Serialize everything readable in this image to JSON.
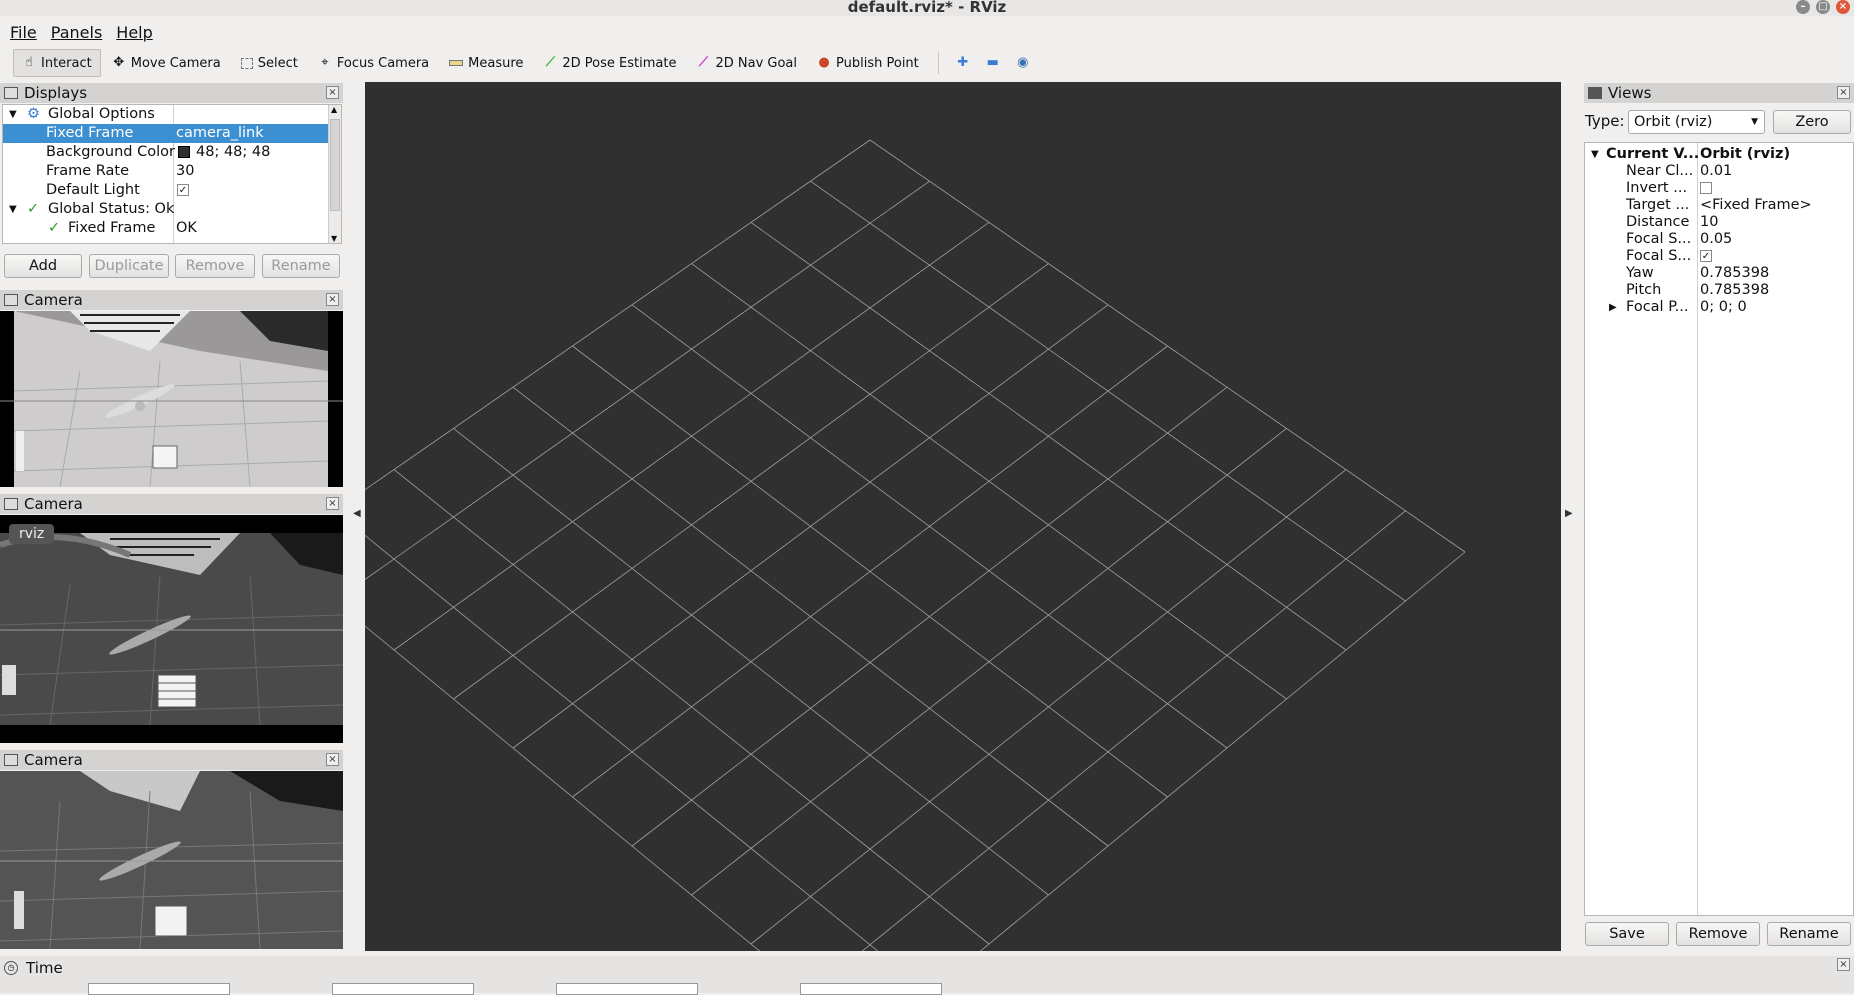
{
  "window": {
    "title": "default.rviz* - RViz"
  },
  "menu": {
    "file": "File",
    "panels": "Panels",
    "help": "Help"
  },
  "toolbar": {
    "interact": "Interact",
    "move_camera": "Move Camera",
    "select": "Select",
    "focus_camera": "Focus Camera",
    "measure": "Measure",
    "pose_estimate": "2D Pose Estimate",
    "nav_goal": "2D Nav Goal",
    "publish_point": "Publish Point"
  },
  "displays": {
    "title": "Displays",
    "rows": [
      {
        "key": "Global Options",
        "value": ""
      },
      {
        "key": "Fixed Frame",
        "value": "camera_link"
      },
      {
        "key": "Background Color",
        "value": "48; 48; 48"
      },
      {
        "key": "Frame Rate",
        "value": "30"
      },
      {
        "key": "Default Light",
        "value": ""
      },
      {
        "key": "Global Status: Ok",
        "value": ""
      },
      {
        "key": "Fixed Frame",
        "value": "OK"
      }
    ],
    "buttons": {
      "add": "Add",
      "duplicate": "Duplicate",
      "remove": "Remove",
      "rename": "Rename"
    }
  },
  "cameras": [
    {
      "title": "Camera",
      "overlay": ""
    },
    {
      "title": "Camera",
      "overlay": "rviz"
    },
    {
      "title": "Camera",
      "overlay": ""
    }
  ],
  "views": {
    "title": "Views",
    "type_label": "Type:",
    "type_value": "Orbit (rviz)",
    "zero": "Zero",
    "rows": [
      {
        "key": "Current V...",
        "value": "Orbit (rviz)"
      },
      {
        "key": "Near Cl...",
        "value": "0.01"
      },
      {
        "key": "Invert ...",
        "value": ""
      },
      {
        "key": "Target ...",
        "value": "<Fixed Frame>"
      },
      {
        "key": "Distance",
        "value": "10"
      },
      {
        "key": "Focal S...",
        "value": "0.05"
      },
      {
        "key": "Focal S...",
        "value": ""
      },
      {
        "key": "Yaw",
        "value": "0.785398"
      },
      {
        "key": "Pitch",
        "value": "0.785398"
      },
      {
        "key": "Focal P...",
        "value": "0; 0; 0"
      }
    ],
    "buttons": {
      "save": "Save",
      "remove": "Remove",
      "rename": "Rename"
    }
  },
  "time": {
    "title": "Time"
  },
  "colors": {
    "viewport_bg": "#303030",
    "selection": "#3c8fd1",
    "grid": "#a0a0a0"
  }
}
